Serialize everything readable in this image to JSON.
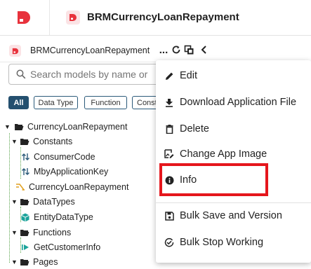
{
  "header": {
    "app_title": "BRMCurrencyLoanRepayment"
  },
  "panel": {
    "app_name": "BRMCurrencyLoanRepayment",
    "more_label": "..."
  },
  "search": {
    "placeholder": "Search models by name or"
  },
  "filters": [
    "All",
    "Data Type",
    "Function",
    "Const"
  ],
  "tree": {
    "root": "CurrencyLoanRepayment",
    "constants": "Constants",
    "consumer_code": "ConsumerCode",
    "mby_application_key": "MbyApplicationKey",
    "model": "CurrencyLoanRepayment",
    "datatypes": "DataTypes",
    "entity_data_type": "EntityDataType",
    "functions": "Functions",
    "get_customer_info": "GetCustomerInfo",
    "pages": "Pages"
  },
  "menu": {
    "edit": "Edit",
    "download": "Download Application File",
    "delete": "Delete",
    "change_image": "Change App Image",
    "info": "Info",
    "bulk_save": "Bulk Save and Version",
    "bulk_stop": "Bulk Stop Working"
  },
  "colors": {
    "brand": "#e8323c",
    "chip_active": "#24506f",
    "highlight": "#e5161c",
    "tree_green": "#58a34a",
    "cube_teal": "#1aa39a"
  }
}
